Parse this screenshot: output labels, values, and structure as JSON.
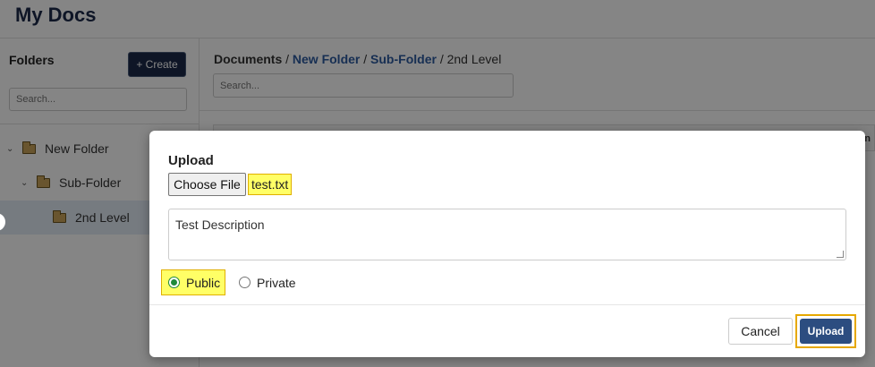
{
  "app": {
    "title": "My Docs"
  },
  "sidebar": {
    "heading": "Folders",
    "create_label": "+ Create",
    "search_placeholder": "Search...",
    "tree": [
      {
        "label": "New Folder",
        "chevron": "⌄",
        "level": 0
      },
      {
        "label": "Sub-Folder",
        "chevron": "⌄",
        "level": 1
      },
      {
        "label": "2nd Level",
        "chevron": "",
        "level": 2,
        "selected": true
      }
    ]
  },
  "main": {
    "breadcrumb": {
      "root": "Documents",
      "sep": " / ",
      "crumb1": "New Folder",
      "crumb2": "Sub-Folder",
      "current": "2nd Level"
    },
    "search_placeholder": "Search...",
    "table_header_partial": "n"
  },
  "modal": {
    "title": "Upload",
    "choose_file_label": "Choose File",
    "file_name": "test.txt",
    "description_value": "Test Description",
    "visibility": {
      "public_label": "Public",
      "private_label": "Private",
      "selected": "Public"
    },
    "cancel_label": "Cancel",
    "upload_label": "Upload"
  },
  "colors": {
    "header_text": "#1b2a4a",
    "primary_button": "#1b2a4a",
    "link": "#2c5aa0",
    "highlight": "#ffff66",
    "highlight_border": "#e0b000",
    "upload_button": "#2c4d80",
    "radio_checked": "#1e8a3a"
  },
  "icons": {
    "folder": "folder-icon",
    "chevron": "chevron-down-icon",
    "radio": "radio-icon"
  }
}
